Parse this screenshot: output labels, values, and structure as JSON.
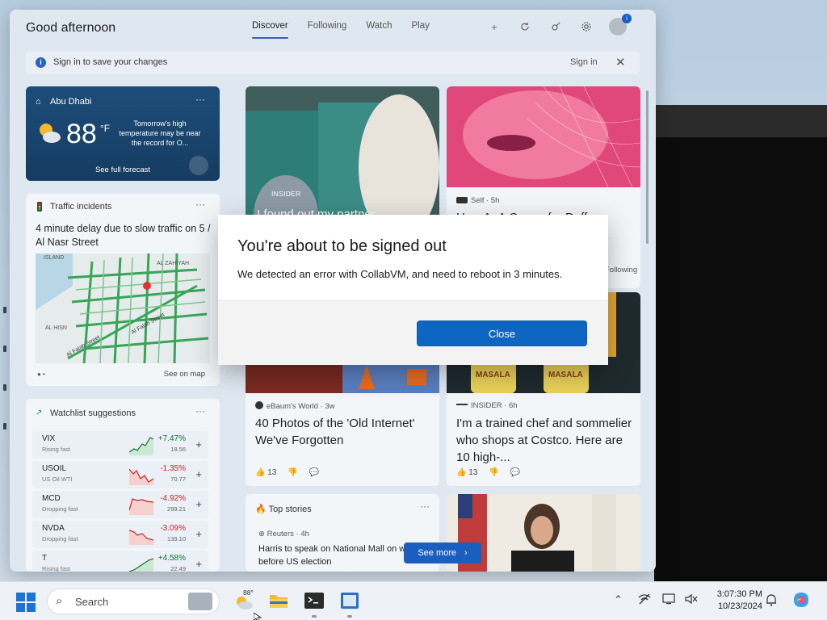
{
  "widgets": {
    "greeting": "Good afternoon",
    "tabs": [
      {
        "label": "Discover"
      },
      {
        "label": "Following"
      },
      {
        "label": "Watch"
      },
      {
        "label": "Play"
      }
    ],
    "avatar_badge": "i",
    "signin_bar": {
      "message": "Sign in to save your changes",
      "link": "Sign in"
    },
    "weather": {
      "location": "Abu Dhabi",
      "temp": "88",
      "unit": "°F",
      "note": "Tomorrow's high temperature may be near the record for O...",
      "link": "See full forecast"
    },
    "traffic": {
      "header": "Traffic incidents",
      "headline": "4 minute delay due to slow traffic on 5 / Al Nasr Street",
      "map_labels": [
        "ISLAND",
        "AL ZAHIYAH",
        "AL HISN",
        "Al Falah Street",
        "Al Falah Street"
      ],
      "link": "See on map"
    },
    "watchlist": {
      "header": "Watchlist suggestions",
      "items": [
        {
          "symbol": "VIX",
          "sub": "Rising fast",
          "pct": "+7.47%",
          "price": "18.56",
          "dir": "up"
        },
        {
          "symbol": "USOIL",
          "sub": "US Oil WTI",
          "pct": "-1.35%",
          "price": "70.77",
          "dir": "down"
        },
        {
          "symbol": "MCD",
          "sub": "Dropping fast",
          "pct": "-4.92%",
          "price": "299.21",
          "dir": "down"
        },
        {
          "symbol": "NVDA",
          "sub": "Dropping fast",
          "pct": "-3.09%",
          "price": "139.10",
          "dir": "down"
        },
        {
          "symbol": "T",
          "sub": "Rising fast",
          "pct": "+4.58%",
          "price": "22.49",
          "dir": "up"
        }
      ]
    },
    "news": {
      "n1": {
        "tag": "INSIDER",
        "title": "I found out my partner"
      },
      "n2": {
        "source": "Self · 5h",
        "title": "How A- A Co...... fo- Duffy",
        "following": "Following"
      },
      "n3": {
        "source": "eBaum's World · 3w",
        "title": "40 Photos of the 'Old Internet' We've Forgotten",
        "likes": "13"
      },
      "n4": {
        "source": "INSIDER · 6h",
        "title": "I'm a trained chef and sommelier who shops at Costco. Here are 10 high-...",
        "likes": "13",
        "can_label": "MASALA"
      },
      "n5": {
        "header": "Top stories",
        "source": "Reuters · 4h",
        "title": "Harris to speak on National Mall on week before US election"
      },
      "see_more": "See more"
    }
  },
  "dialog": {
    "title": "You're about to be signed out",
    "message": "We detected an error with CollabVM, and need to reboot in 3 minutes.",
    "close_label": "Close"
  },
  "taskbar": {
    "search_placeholder": "Search",
    "weather_temp": "88°",
    "time": "3:07:30 PM",
    "date": "10/23/2024"
  },
  "colors": {
    "accent": "#0f66c2",
    "weather_card": "#1d4d7a",
    "up": "#137333",
    "down": "#c5221f"
  }
}
